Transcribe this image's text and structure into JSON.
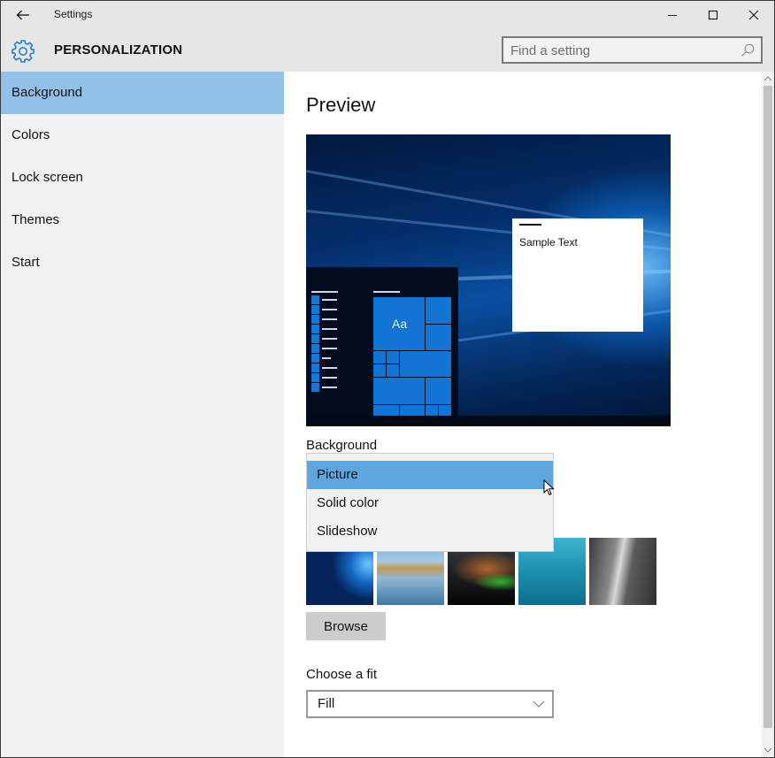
{
  "window": {
    "title": "Settings",
    "controls": {
      "minimize": "minimize",
      "maximize": "maximize",
      "close": "close"
    }
  },
  "header": {
    "section_title": "PERSONALIZATION",
    "search": {
      "placeholder": "Find a setting",
      "value": ""
    }
  },
  "sidebar": {
    "items": [
      {
        "label": "Background",
        "active": true
      },
      {
        "label": "Colors",
        "active": false
      },
      {
        "label": "Lock screen",
        "active": false
      },
      {
        "label": "Themes",
        "active": false
      },
      {
        "label": "Start",
        "active": false
      }
    ]
  },
  "main": {
    "preview_title": "Preview",
    "preview": {
      "sample_text": "Sample Text",
      "tile_text": "Aa"
    },
    "background": {
      "label": "Background",
      "options": [
        "Picture",
        "Solid color",
        "Slideshow"
      ],
      "selected": "Picture"
    },
    "recent_pictures": [
      {
        "name": "windows-hero-wallpaper"
      },
      {
        "name": "beach-rocks-wallpaper"
      },
      {
        "name": "night-tent-wallpaper"
      },
      {
        "name": "underwater-swimmer-wallpaper"
      },
      {
        "name": "rock-face-wallpaper"
      }
    ],
    "browse_label": "Browse",
    "fit": {
      "label": "Choose a fit",
      "value": "Fill"
    }
  },
  "colors": {
    "accent": "#0078d7",
    "sidebar_active": "#91c1e8",
    "dropdown_selected": "#5ea6df"
  }
}
